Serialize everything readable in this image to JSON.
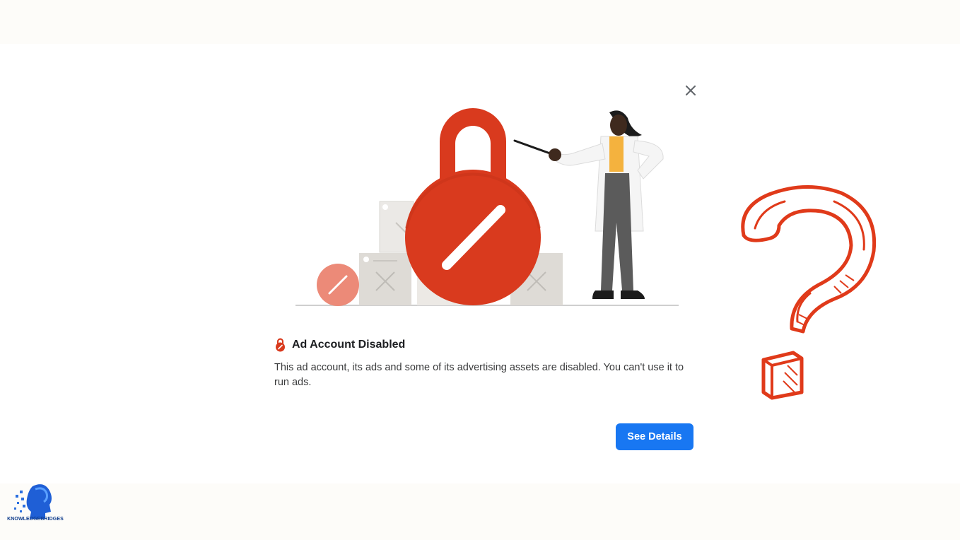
{
  "dialog": {
    "title": "Ad Account Disabled",
    "message": "This ad account, its ads and some of its advertising assets are disabled. You can't use it to run ads.",
    "primary_button_label": "See Details",
    "close_icon": "close-icon",
    "title_icon": "lock-icon",
    "accent_color": "#1877f2",
    "alert_color": "#d93a1e"
  },
  "overlay": {
    "question_mark_icon": "question-mark-icon"
  },
  "brand": {
    "logo_icon": "knowledgebridges-logo",
    "name": "KNOWLEDGEBRIDGES"
  }
}
